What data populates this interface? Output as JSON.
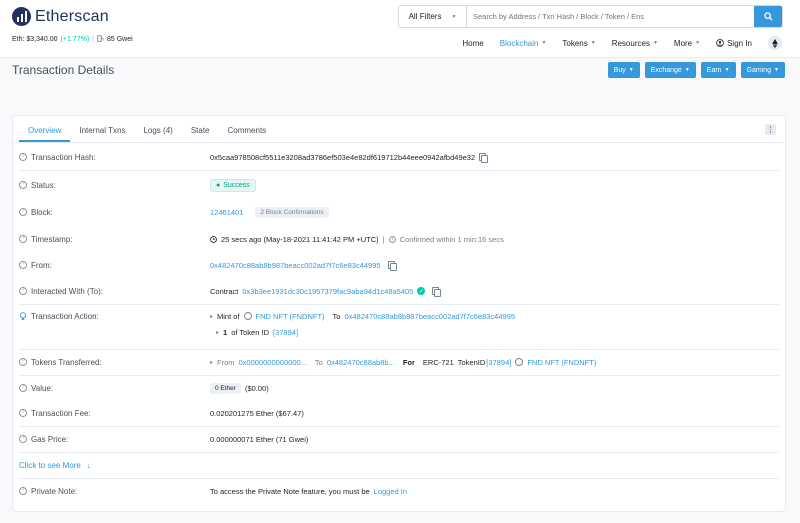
{
  "brand": {
    "name": "Etherscan"
  },
  "stats": {
    "eth_label": "Eth: $3,340.00",
    "eth_change": "(+1.77%)",
    "separator": "|",
    "gas": "85 Gwei"
  },
  "search": {
    "filter": "All Filters",
    "placeholder": "Search by Address / Txn Hash / Block / Token / Ens"
  },
  "nav": {
    "home": "Home",
    "blockchain": "Blockchain",
    "tokens": "Tokens",
    "resources": "Resources",
    "more": "More",
    "signin": "Sign In"
  },
  "page": {
    "title": "Transaction Details"
  },
  "actions": {
    "buy": "Buy",
    "exchange": "Exchange",
    "earn": "Earn",
    "gaming": "Gaming"
  },
  "tabs": {
    "overview": "Overview",
    "internal": "Internal Txns",
    "logs": "Logs (4)",
    "state": "State",
    "comments": "Comments"
  },
  "details": {
    "hash_label": "Transaction Hash:",
    "hash": "0x5caa978508cf5511e3208ad3786ef503e4e82df619712b44eee0942afbd49e32",
    "status_label": "Status:",
    "status": "Success",
    "block_label": "Block:",
    "block": "12461401",
    "confirmations": "2 Block Confirmations",
    "timestamp_label": "Timestamp:",
    "timestamp": "25 secs ago (May-18-2021 11:41:42 PM +UTC)",
    "confirmed": "Confirmed within 1 min:16 secs",
    "from_label": "From:",
    "from": "0x482470c88ab8b987beacc002ad7f7c6e83c44995",
    "to_label": "Interacted With (To):",
    "contract_prefix": "Contract",
    "contract": "0x3b3ee1931dc30c1957379fac9aba94d1c48a5405",
    "action_label": "Transaction Action:",
    "mint_of": "Mint of",
    "nft": "FND NFT (FNDNFT)",
    "to_word": "To",
    "mint_to": "0x482470c88ab8b987beacc002ad7f7c6e83c44995",
    "amount": "1",
    "of_token_id": "of Token ID",
    "token_id": "[37894]",
    "tokens_label": "Tokens Transferred:",
    "tf_from_word": "From",
    "tf_from": "0x0000000000000...",
    "tf_to_word": "To",
    "tf_to": "0x482470c88ab8b...",
    "for_word": "For",
    "erc": "ERC-721",
    "token_id_word": "TokenID",
    "value_label": "Value:",
    "value_ether": "0 Ether",
    "value_usd": "($0.00)",
    "fee_label": "Transaction Fee:",
    "fee": "0.020201275 Ether ($67.47)",
    "gas_label": "Gas Price:",
    "gas": "0.000000071 Ether (71 Gwei)",
    "see_more": "Click to see More",
    "note_label": "Private Note:",
    "note_text": "To access the Private Note feature, you must be",
    "logged_in": "Logged In"
  },
  "colors": {
    "accent": "#3498db",
    "success": "#00c9a7",
    "brand": "#21325b"
  }
}
